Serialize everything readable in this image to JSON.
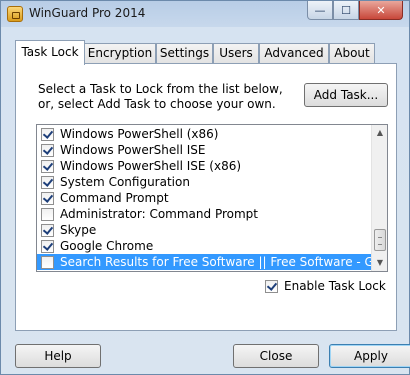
{
  "window": {
    "title": "WinGuard Pro 2014"
  },
  "caption_buttons": {
    "minimize": "—",
    "maximize": "☐",
    "close": "✕"
  },
  "tabs": [
    {
      "label": "Task Lock",
      "active": true
    },
    {
      "label": "Encryption",
      "active": false
    },
    {
      "label": "Settings",
      "active": false
    },
    {
      "label": "Users",
      "active": false
    },
    {
      "label": "Advanced",
      "active": false
    },
    {
      "label": "About",
      "active": false
    }
  ],
  "task_lock": {
    "instruction_line1": "Select a Task to Lock from the list below,",
    "instruction_line2": "or, select Add Task to choose your own.",
    "add_task_label": "Add Task...",
    "items": [
      {
        "label": "Windows PowerShell (x86)",
        "checked": true,
        "selected": false
      },
      {
        "label": "Windows PowerShell ISE",
        "checked": true,
        "selected": false
      },
      {
        "label": "Windows PowerShell ISE (x86)",
        "checked": true,
        "selected": false
      },
      {
        "label": "System Configuration",
        "checked": true,
        "selected": false
      },
      {
        "label": "Command Prompt",
        "checked": true,
        "selected": false
      },
      {
        "label": "Administrator: Command Prompt",
        "checked": false,
        "selected": false
      },
      {
        "label": "Skype",
        "checked": true,
        "selected": false
      },
      {
        "label": "Google Chrome",
        "checked": true,
        "selected": false
      },
      {
        "label": "Search Results for Free Software || Free Software - Go",
        "checked": false,
        "selected": true
      }
    ],
    "enable_label": "Enable Task Lock",
    "enable_checked": true
  },
  "footer": {
    "help_label": "Help",
    "close_label": "Close",
    "apply_label": "Apply"
  }
}
